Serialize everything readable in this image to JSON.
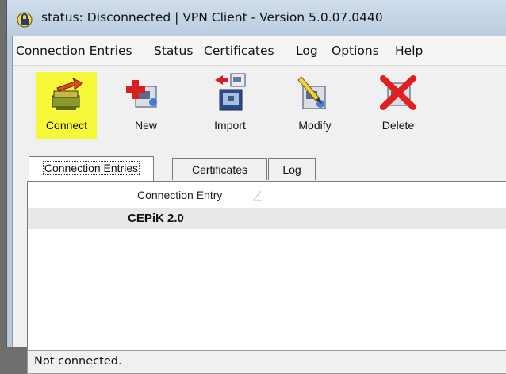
{
  "window": {
    "title": "status: Disconnected | VPN Client - Version 5.0.07.0440",
    "title_icon": "vpn-lock-icon"
  },
  "menubar": {
    "items": [
      "Connection Entries",
      "Status",
      "Certificates",
      "Log",
      "Options",
      "Help"
    ]
  },
  "toolbar": {
    "buttons": [
      {
        "label": "Connect",
        "icon": "connect-icon",
        "highlighted": true,
        "highlight_color": "#f6f83a"
      },
      {
        "label": "New",
        "icon": "new-entry-icon"
      },
      {
        "label": "Import",
        "icon": "import-icon"
      },
      {
        "label": "Modify",
        "icon": "modify-icon"
      },
      {
        "label": "Delete",
        "icon": "delete-icon"
      }
    ]
  },
  "tabs": [
    {
      "label": "Connection Entries",
      "active": true
    },
    {
      "label": "Certificates",
      "active": false
    },
    {
      "label": "Log",
      "active": false
    }
  ],
  "table": {
    "columns": [
      "Connection Entry"
    ],
    "sort_icon": "sort-triangle-icon",
    "rows": [
      {
        "entry": "CEPiK 2.0"
      }
    ]
  },
  "statusbar": {
    "text": "Not connected."
  },
  "colors": {
    "titlebar": "#c6d5e6",
    "highlight": "#f6f83a",
    "delete_red": "#e02020"
  }
}
